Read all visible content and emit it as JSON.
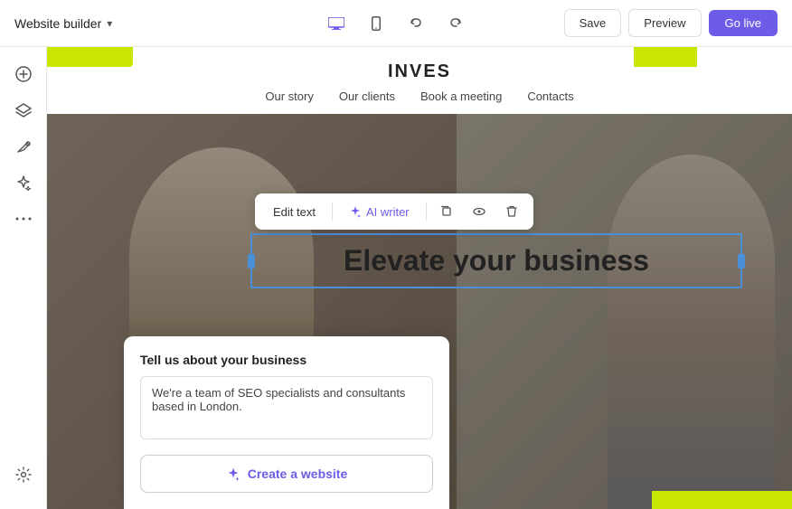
{
  "topbar": {
    "brand": "Website builder",
    "save_label": "Save",
    "preview_label": "Preview",
    "golive_label": "Go live"
  },
  "sidebar": {
    "items": [
      {
        "icon": "+",
        "name": "add"
      },
      {
        "icon": "◇",
        "name": "layers"
      },
      {
        "icon": "✏",
        "name": "edit"
      },
      {
        "icon": "✦",
        "name": "ai"
      },
      {
        "icon": "⋯",
        "name": "more"
      }
    ],
    "bottom": [
      {
        "icon": "⚙",
        "name": "settings"
      }
    ]
  },
  "site": {
    "logo": "INVES",
    "nav": [
      "Our story",
      "Our clients",
      "Book a meeting",
      "Contacts"
    ],
    "hero_text": "Elevate your business"
  },
  "toolbar": {
    "edit_text": "Edit text",
    "ai_writer": "AI writer",
    "icons": [
      "copy",
      "eye",
      "trash"
    ]
  },
  "ai_panel": {
    "title": "Tell us about your business",
    "textarea_value": "We're a team of SEO specialists and consultants based in London.",
    "button_label": "Create a website"
  }
}
